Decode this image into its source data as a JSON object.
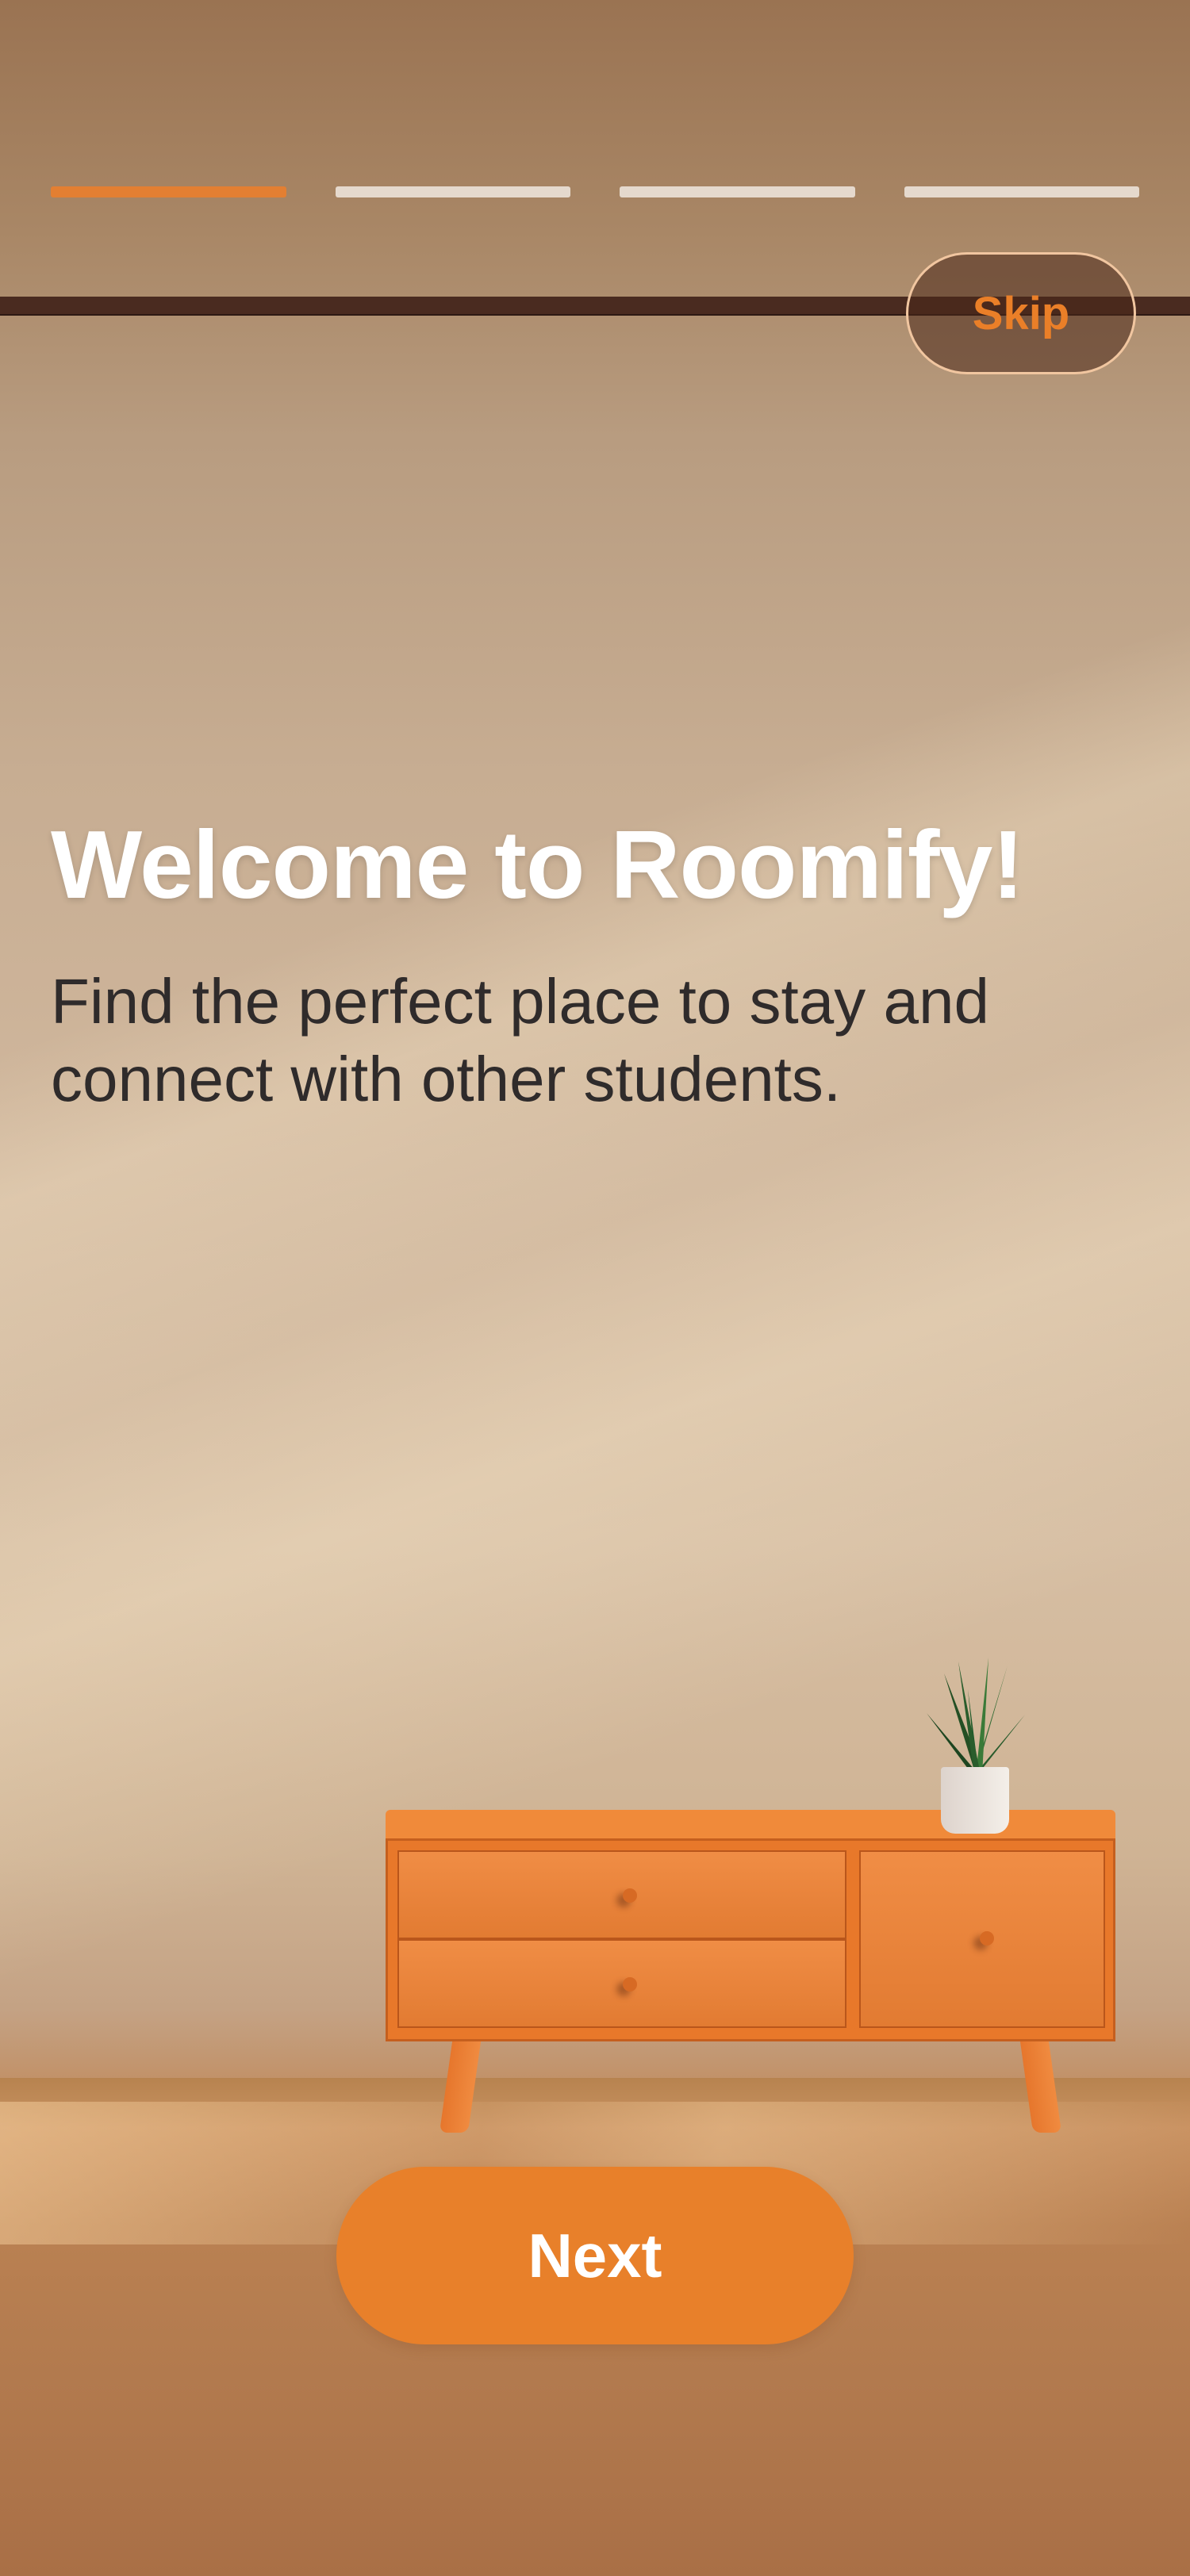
{
  "progress": {
    "total_steps": 4,
    "current_step": 1,
    "active_color": "#E37F32",
    "inactive_color": "#E5D9CD"
  },
  "skip": {
    "label": "Skip",
    "color": "#EA7F28"
  },
  "hero": {
    "title": "Welcome to Roomify!",
    "subtitle": "Find the perfect place to stay and connect with other students."
  },
  "next": {
    "label": "Next",
    "color": "#E8802A"
  },
  "illustration": {
    "icon": "dresser-with-plant-illustration"
  }
}
